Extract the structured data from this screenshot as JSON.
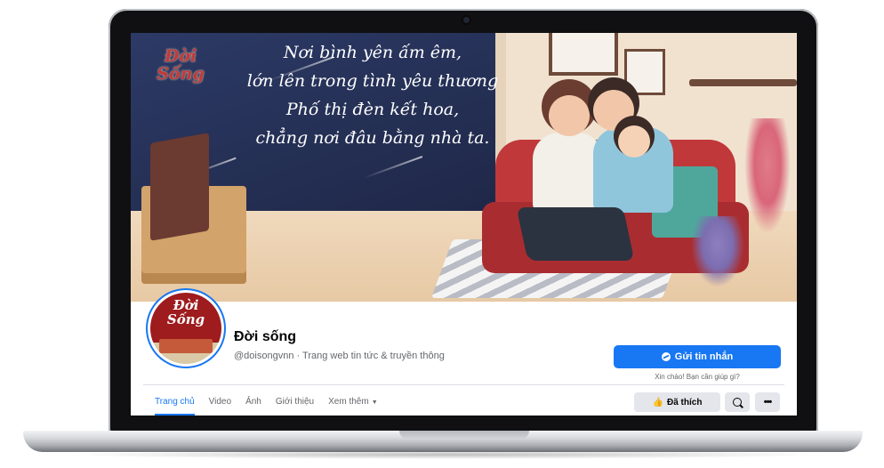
{
  "cover": {
    "logo_text": "Đời Sống",
    "poem_lines": [
      "Nơi bình yên ấm êm,",
      "lớn lên trong tình yêu thương",
      "Phố thị đèn kết hoa,",
      "chẳng nơi đâu bằng nhà ta."
    ]
  },
  "profile": {
    "avatar_text": "Đời Sống",
    "name": "Đời sống",
    "handle_line": "@doisongvnn · Trang web tin tức & truyền thông"
  },
  "actions": {
    "message_label": "Gửi tin nhắn",
    "greeting": "Xin chào! Bạn cần giúp gì?",
    "liked_label": "Đã thích",
    "more_glyph": "•••"
  },
  "tabs": [
    {
      "label": "Trang chủ",
      "active": true
    },
    {
      "label": "Video",
      "active": false
    },
    {
      "label": "Ảnh",
      "active": false
    },
    {
      "label": "Giới thiệu",
      "active": false
    },
    {
      "label": "Xem thêm",
      "active": false
    }
  ],
  "icons": {
    "messenger": "messenger-icon",
    "like": "thumbs-up-icon",
    "search": "search-icon",
    "more": "more-dots-icon",
    "caret": "caret-down-icon"
  },
  "colors": {
    "accent": "#1877f2",
    "button_gray": "#e4e6eb",
    "text_primary": "#050505",
    "text_secondary": "#65676b"
  }
}
